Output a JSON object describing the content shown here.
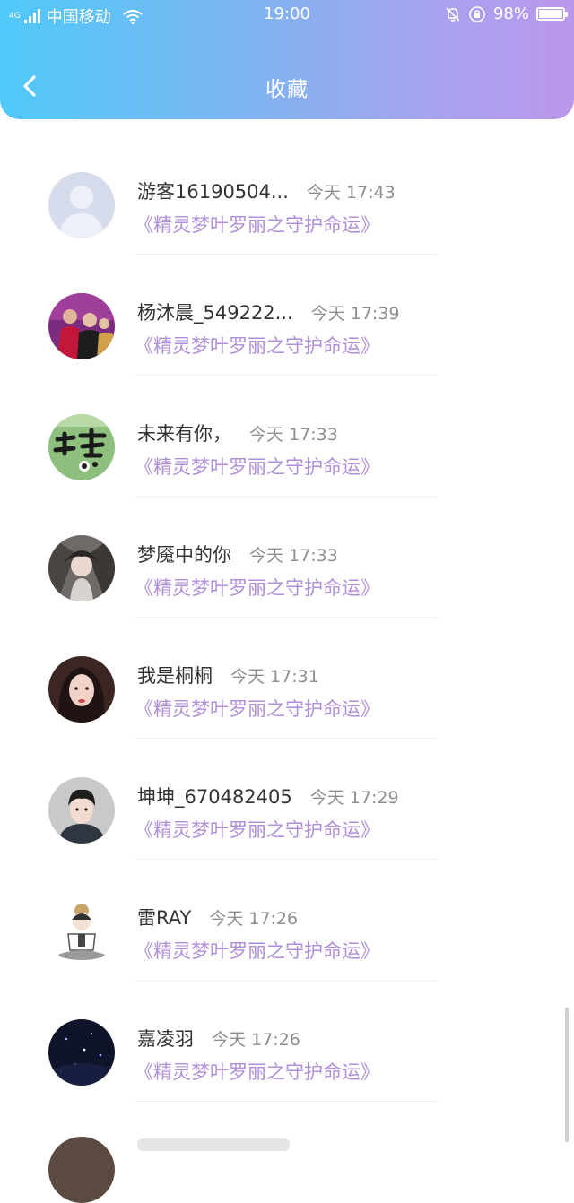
{
  "status_bar": {
    "network_tag": "4G",
    "carrier": "中国移动",
    "time": "19:00",
    "battery": "98%",
    "battery_level": 0.98
  },
  "header": {
    "title": "收藏",
    "back_icon": "chevron-left-icon"
  },
  "list": [
    {
      "username": "游客16190504...",
      "time": "今天 17:43",
      "title": "《精灵梦叶罗丽之守护命运》",
      "avatar": "default-avatar"
    },
    {
      "username": "杨沐晨_549222...",
      "time": "今天 17:39",
      "title": "《精灵梦叶罗丽之守护命运》",
      "avatar": "photo-avatar"
    },
    {
      "username": "未来有你，",
      "time": "今天 17:33",
      "title": "《精灵梦叶罗丽之守护命运》",
      "avatar": "calligraphy-avatar"
    },
    {
      "username": "梦魇中的你",
      "time": "今天 17:33",
      "title": "《精灵梦叶罗丽之守护命运》",
      "avatar": "anime-avatar"
    },
    {
      "username": "我是桐桐",
      "time": "今天 17:31",
      "title": "《精灵梦叶罗丽之守护命运》",
      "avatar": "portrait-avatar"
    },
    {
      "username": "坤坤_670482405",
      "time": "今天 17:29",
      "title": "《精灵梦叶罗丽之守护命运》",
      "avatar": "portrait-avatar"
    },
    {
      "username": "雷RAY",
      "time": "今天 17:26",
      "title": "《精灵梦叶罗丽之守护命运》",
      "avatar": "cartoon-avatar"
    },
    {
      "username": "嘉凌羽",
      "time": "今天 17:26",
      "title": "《精灵梦叶罗丽之守护命运》",
      "avatar": "night-sky-avatar"
    }
  ],
  "colors": {
    "gradient_start": "#4fc9f8",
    "gradient_end": "#bb97ec",
    "link": "#b08fd8",
    "time": "#8e8e8e"
  }
}
